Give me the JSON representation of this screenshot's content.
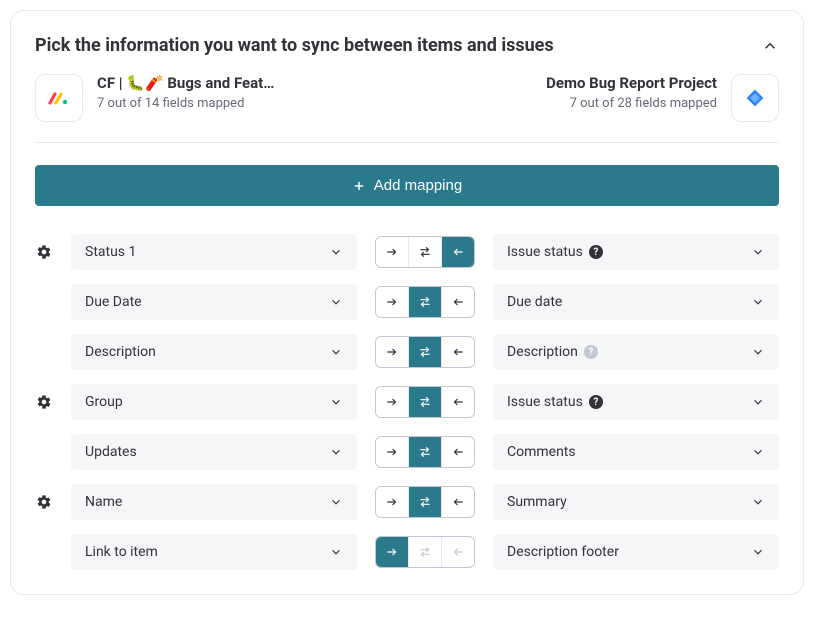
{
  "header": {
    "title": "Pick the information you want to sync between items and issues"
  },
  "left_source": {
    "name": "CF | 🐛🧨 Bugs and Feat…",
    "sub": "7 out of 14 fields mapped"
  },
  "right_source": {
    "name": "Demo Bug Report Project",
    "sub": "7 out of 28 fields mapped"
  },
  "add_button": "Add mapping",
  "rows": [
    {
      "left": "Status 1",
      "right": "Issue status",
      "gear": true,
      "direction": "left",
      "help": "dark"
    },
    {
      "left": "Due Date",
      "right": "Due date",
      "gear": false,
      "direction": "both",
      "help": null
    },
    {
      "left": "Description",
      "right": "Description",
      "gear": false,
      "direction": "both",
      "help": "grey"
    },
    {
      "left": "Group",
      "right": "Issue status",
      "gear": true,
      "direction": "both",
      "help": "dark"
    },
    {
      "left": "Updates",
      "right": "Comments",
      "gear": false,
      "direction": "both",
      "help": null
    },
    {
      "left": "Name",
      "right": "Summary",
      "gear": true,
      "direction": "both",
      "help": null
    },
    {
      "left": "Link to item",
      "right": "Description footer",
      "gear": false,
      "direction": "right-only",
      "help": null
    }
  ]
}
